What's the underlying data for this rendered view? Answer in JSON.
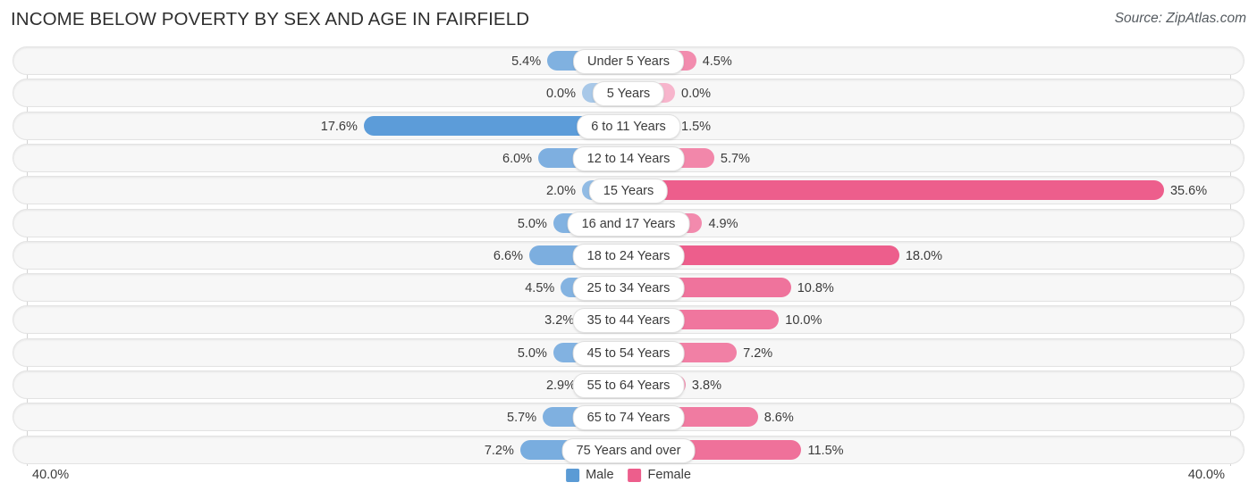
{
  "header": {
    "title": "INCOME BELOW POVERTY BY SEX AND AGE IN FAIRFIELD",
    "source": "Source: ZipAtlas.com"
  },
  "footer": {
    "axis_left": "40.0%",
    "axis_right": "40.0%"
  },
  "legend": {
    "items": [
      {
        "label": "Male",
        "color": "#5B9BD5"
      },
      {
        "label": "Female",
        "color": "#ED5E8C"
      }
    ]
  },
  "colors": {
    "male_strong": "#5B9BD9",
    "male_weak": "#A8C8E8",
    "female_strong": "#ED5E8C",
    "female_weak": "#F7B5CC",
    "track": "#f7f7f7",
    "track_border": "#e3e3e3",
    "axis_line": "#d2d2d2"
  },
  "chart_data": {
    "type": "bar",
    "orientation": "horizontal-diverging",
    "title": "INCOME BELOW POVERTY BY SEX AND AGE IN FAIRFIELD",
    "xlabel": "",
    "ylabel": "",
    "xlim": [
      40.0,
      40.0
    ],
    "axis_max_percent": 40.0,
    "grid": false,
    "legend_position": "bottom-center",
    "categories": [
      "Under 5 Years",
      "5 Years",
      "6 to 11 Years",
      "12 to 14 Years",
      "15 Years",
      "16 and 17 Years",
      "18 to 24 Years",
      "25 to 34 Years",
      "35 to 44 Years",
      "45 to 54 Years",
      "55 to 64 Years",
      "65 to 74 Years",
      "75 Years and over"
    ],
    "series": [
      {
        "name": "Male",
        "values": [
          5.4,
          0.0,
          17.6,
          6.0,
          2.0,
          5.0,
          6.6,
          4.5,
          3.2,
          5.0,
          2.9,
          5.7,
          7.2
        ],
        "labels": [
          "5.4%",
          "0.0%",
          "17.6%",
          "6.0%",
          "2.0%",
          "5.0%",
          "6.6%",
          "4.5%",
          "3.2%",
          "5.0%",
          "2.9%",
          "5.7%",
          "7.2%"
        ]
      },
      {
        "name": "Female",
        "values": [
          4.5,
          0.0,
          1.5,
          5.7,
          35.6,
          4.9,
          18.0,
          10.8,
          10.0,
          7.2,
          3.8,
          8.6,
          11.5
        ],
        "labels": [
          "4.5%",
          "0.0%",
          "1.5%",
          "5.7%",
          "35.6%",
          "4.9%",
          "18.0%",
          "10.8%",
          "10.0%",
          "7.2%",
          "3.8%",
          "8.6%",
          "11.5%"
        ]
      }
    ]
  },
  "rows": [
    {
      "category": "Under 5 Years",
      "male": "5.4%",
      "female": "4.5%"
    },
    {
      "category": "5 Years",
      "male": "0.0%",
      "female": "0.0%"
    },
    {
      "category": "6 to 11 Years",
      "male": "17.6%",
      "female": "1.5%"
    },
    {
      "category": "12 to 14 Years",
      "male": "6.0%",
      "female": "5.7%"
    },
    {
      "category": "15 Years",
      "male": "2.0%",
      "female": "35.6%"
    },
    {
      "category": "16 and 17 Years",
      "male": "5.0%",
      "female": "4.9%"
    },
    {
      "category": "18 to 24 Years",
      "male": "6.6%",
      "female": "18.0%"
    },
    {
      "category": "25 to 34 Years",
      "male": "4.5%",
      "female": "10.8%"
    },
    {
      "category": "35 to 44 Years",
      "male": "3.2%",
      "female": "10.0%"
    },
    {
      "category": "45 to 54 Years",
      "male": "5.0%",
      "female": "7.2%"
    },
    {
      "category": "55 to 64 Years",
      "male": "2.9%",
      "female": "3.8%"
    },
    {
      "category": "65 to 74 Years",
      "male": "5.7%",
      "female": "8.6%"
    },
    {
      "category": "75 Years and over",
      "male": "7.2%",
      "female": "11.5%"
    }
  ]
}
